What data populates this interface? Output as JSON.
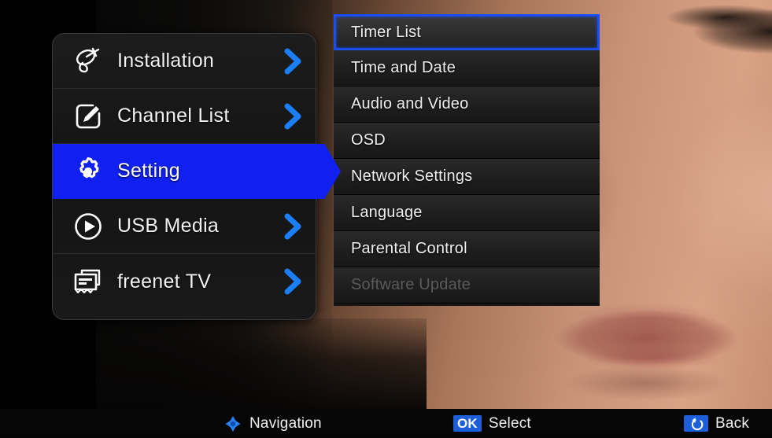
{
  "screen": {
    "title": "Set-top box Settings menu",
    "background_description": "close-up photograph of a woman's face"
  },
  "main_menu": {
    "items": [
      {
        "label": "Installation",
        "icon": "satellite-dish-icon",
        "selected": false,
        "has_arrow": true
      },
      {
        "label": "Channel List",
        "icon": "pencil-edit-icon",
        "selected": false,
        "has_arrow": true
      },
      {
        "label": "Setting",
        "icon": "gear-icon",
        "selected": true,
        "has_arrow": false
      },
      {
        "label": "USB Media",
        "icon": "play-circle-icon",
        "selected": false,
        "has_arrow": true
      },
      {
        "label": "freenet TV",
        "icon": "card-stack-icon",
        "selected": false,
        "has_arrow": true
      }
    ]
  },
  "submenu": {
    "items": [
      {
        "label": "Timer List",
        "highlighted": true,
        "disabled": false
      },
      {
        "label": "Time and Date",
        "highlighted": false,
        "disabled": false
      },
      {
        "label": "Audio and Video",
        "highlighted": false,
        "disabled": false
      },
      {
        "label": "OSD",
        "highlighted": false,
        "disabled": false
      },
      {
        "label": "Network Settings",
        "highlighted": false,
        "disabled": false
      },
      {
        "label": "Language",
        "highlighted": false,
        "disabled": false
      },
      {
        "label": "Parental Control",
        "highlighted": false,
        "disabled": false
      },
      {
        "label": "Software Update",
        "highlighted": false,
        "disabled": true
      }
    ]
  },
  "status_bar": {
    "navigation": {
      "label": "Navigation",
      "icon": "dpad-icon"
    },
    "select": {
      "key": "OK",
      "label": "Select"
    },
    "back": {
      "label": "Back",
      "icon": "return-arrow-icon"
    }
  },
  "colors": {
    "accent_blue": "#1020f0",
    "badge_blue": "#1d5fd8",
    "highlight_border": "#1a4ef0",
    "panel_dark": "#161616",
    "text_primary": "#f0f0f0",
    "text_disabled": "#5a5a5a"
  }
}
